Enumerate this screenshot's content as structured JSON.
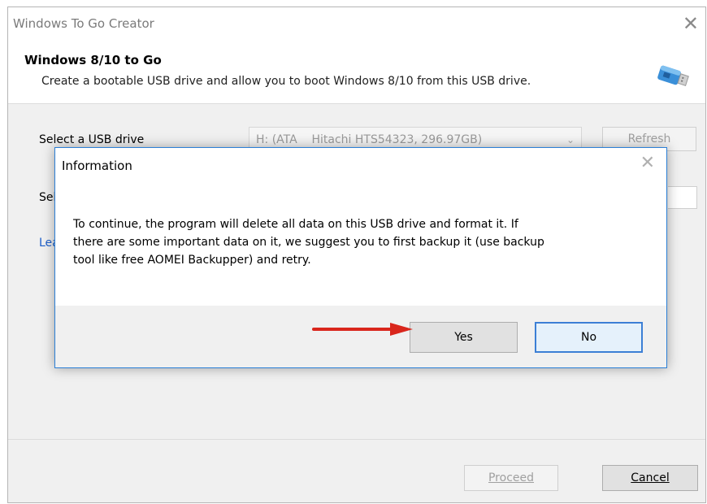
{
  "window": {
    "title": "Windows To Go Creator",
    "close_glyph": "✕"
  },
  "header": {
    "title": "Windows 8/10 to Go",
    "description": "Create a bootable USB drive and allow you to boot Windows 8/10 from this USB drive.",
    "icon": "usb-drive-icon"
  },
  "form": {
    "usb_label": "Select a USB drive",
    "usb_value": "H: (ATA    Hitachi HTS54323, 296.97GB)",
    "refresh_label": "Refresh",
    "second_label_partial": "Sel",
    "link_partial": "Lea"
  },
  "footer": {
    "proceed_label": "Proceed",
    "cancel_label": "Cancel"
  },
  "dialog": {
    "title": "Information",
    "close_glyph": "✕",
    "message_line1": "To continue, the program will delete all data on this USB drive and format it. If",
    "message_line2": "there are some important data on it, we suggest you to first backup it (use backup",
    "message_line3": "tool like free AOMEI Backupper) and retry.",
    "yes_label": "Yes",
    "no_label": "No"
  },
  "colors": {
    "accent": "#2b7fd6",
    "arrow": "#d9261c",
    "link": "#1c5ec9"
  }
}
